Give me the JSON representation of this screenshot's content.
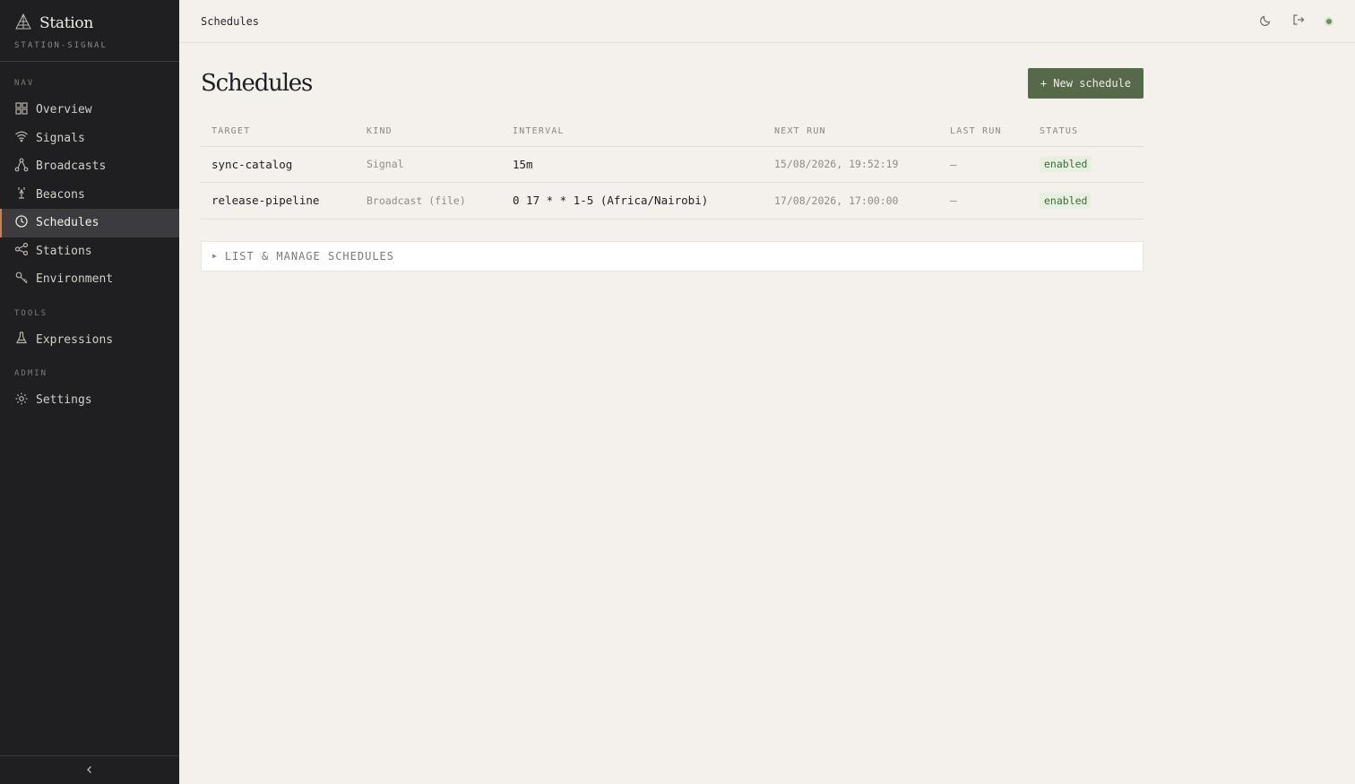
{
  "app": {
    "brand": "Station",
    "workspace": "STATION-SIGNAL"
  },
  "sidebar": {
    "sections": [
      {
        "label": "NAV",
        "items": [
          {
            "label": "Overview",
            "icon": "grid-icon"
          },
          {
            "label": "Signals",
            "icon": "wifi-icon"
          },
          {
            "label": "Broadcasts",
            "icon": "fork-icon"
          },
          {
            "label": "Beacons",
            "icon": "beacon-icon"
          },
          {
            "label": "Schedules",
            "icon": "clock-icon",
            "active": true
          },
          {
            "label": "Stations",
            "icon": "network-icon"
          },
          {
            "label": "Environment",
            "icon": "key-icon"
          }
        ]
      },
      {
        "label": "TOOLS",
        "items": [
          {
            "label": "Expressions",
            "icon": "flask-icon"
          }
        ]
      },
      {
        "label": "ADMIN",
        "items": [
          {
            "label": "Settings",
            "icon": "gear-icon"
          }
        ]
      }
    ],
    "collapse_icon": "chevron-left-icon"
  },
  "topbar": {
    "title": "Schedules",
    "icons": [
      "moon-icon",
      "logout-icon",
      "status-dot"
    ]
  },
  "page": {
    "title": "Schedules",
    "new_button": "+ New schedule"
  },
  "table": {
    "columns": [
      "TARGET",
      "KIND",
      "INTERVAL",
      "NEXT RUN",
      "LAST RUN",
      "STATUS"
    ],
    "rows": [
      {
        "target": "sync-catalog",
        "kind": "Signal",
        "interval": "15m",
        "next_run": "15/08/2026, 19:52:19",
        "last_run": "—",
        "status": "enabled"
      },
      {
        "target": "release-pipeline",
        "kind": "Broadcast (file)",
        "interval": "0 17 * * 1-5 (Africa/Nairobi)",
        "next_run": "17/08/2026, 17:00:00",
        "last_run": "—",
        "status": "enabled"
      }
    ]
  },
  "accordion": {
    "label": "LIST & MANAGE SCHEDULES"
  },
  "colors": {
    "sidebar_bg": "#1f1f22",
    "page_bg": "#f4f1ec",
    "accent": "#c9814a",
    "primary_button": "#56694a",
    "badge_bg": "#e6efe0",
    "badge_text": "#3d6e34",
    "status_dot": "#6b8f5e"
  }
}
